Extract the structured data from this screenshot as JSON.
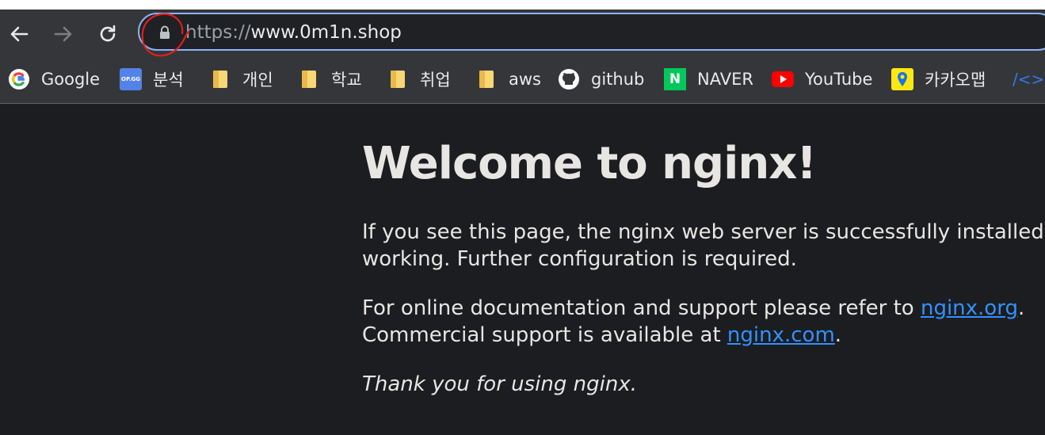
{
  "browser": {
    "url_scheme": "https://",
    "url_host": "www.0m1n.shop"
  },
  "bookmarks": [
    {
      "label": "Google",
      "icon": "google-icon"
    },
    {
      "label": "분석",
      "icon": "opgg-icon",
      "icon_text": "OP.GG"
    },
    {
      "label": "개인",
      "icon": "folder-icon"
    },
    {
      "label": "학교",
      "icon": "folder-icon"
    },
    {
      "label": "취업",
      "icon": "folder-icon"
    },
    {
      "label": "aws",
      "icon": "folder-icon"
    },
    {
      "label": "github",
      "icon": "github-icon"
    },
    {
      "label": "NAVER",
      "icon": "naver-icon",
      "icon_text": "N"
    },
    {
      "label": "YouTube",
      "icon": "youtube-icon"
    },
    {
      "label": "카카오맵",
      "icon": "kakaomap-icon"
    },
    {
      "label": "",
      "icon": "code-icon",
      "icon_text": "/<>"
    }
  ],
  "page": {
    "heading": "Welcome to nginx!",
    "para1_line1": "If you see this page, the nginx web server is successfully installed and",
    "para1_line2": "working. Further configuration is required.",
    "para2_line1_pre": "For online documentation and support please refer to ",
    "para2_link1": "nginx.org",
    "para2_line1_post": ".",
    "para2_line2_pre": "Commercial support is available at ",
    "para2_link2": "nginx.com",
    "para2_line2_post": ".",
    "para3": "Thank you for using nginx."
  },
  "colors": {
    "toolbar": "#35363a",
    "page_background": "#1c1d20",
    "link": "#3391ff",
    "focus_ring": "#8ab4f8",
    "annotation": "#e0201e"
  }
}
